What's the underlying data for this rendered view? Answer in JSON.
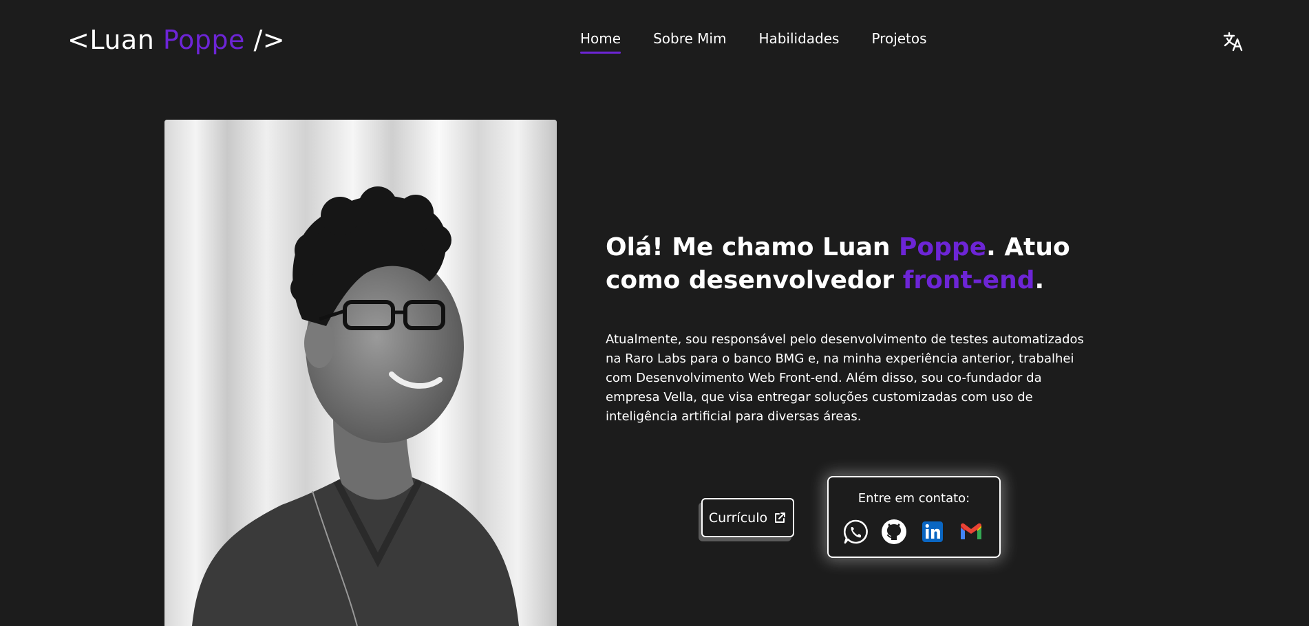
{
  "header": {
    "logo_open": "<",
    "logo_first": "Luan",
    "logo_last": "Poppe",
    "logo_close": "/>",
    "nav": [
      {
        "label": "Home",
        "active": true
      },
      {
        "label": "Sobre Mim",
        "active": false
      },
      {
        "label": "Habilidades",
        "active": false
      },
      {
        "label": "Projetos",
        "active": false
      }
    ],
    "translate_icon": "translate-icon"
  },
  "hero": {
    "headline_part1": "Olá! Me chamo Luan ",
    "headline_accent1": "Poppe",
    "headline_part2": ". Atuo como desenvolvedor ",
    "headline_accent2": "front-end",
    "headline_part3": ".",
    "description": "Atualmente, sou responsável pelo desenvolvimento de testes automatizados na Raro Labs para o banco BMG e, na minha experiência anterior, trabalhei com Desenvolvimento Web Front-end. Além disso, sou co-fundador da empresa Vella, que visa entregar soluções customizadas com uso de inteligência artificial para diversas áreas.",
    "cv_label": "Currículo",
    "cv_icon": "external-link-icon",
    "contact_title": "Entre em contato:",
    "contact_icons": [
      "whatsapp-icon",
      "github-icon",
      "linkedin-icon",
      "gmail-icon"
    ]
  },
  "colors": {
    "background": "#1c1c1c",
    "accent": "#6d25d6",
    "text": "#ffffff",
    "linkedin": "#0a66c2"
  }
}
